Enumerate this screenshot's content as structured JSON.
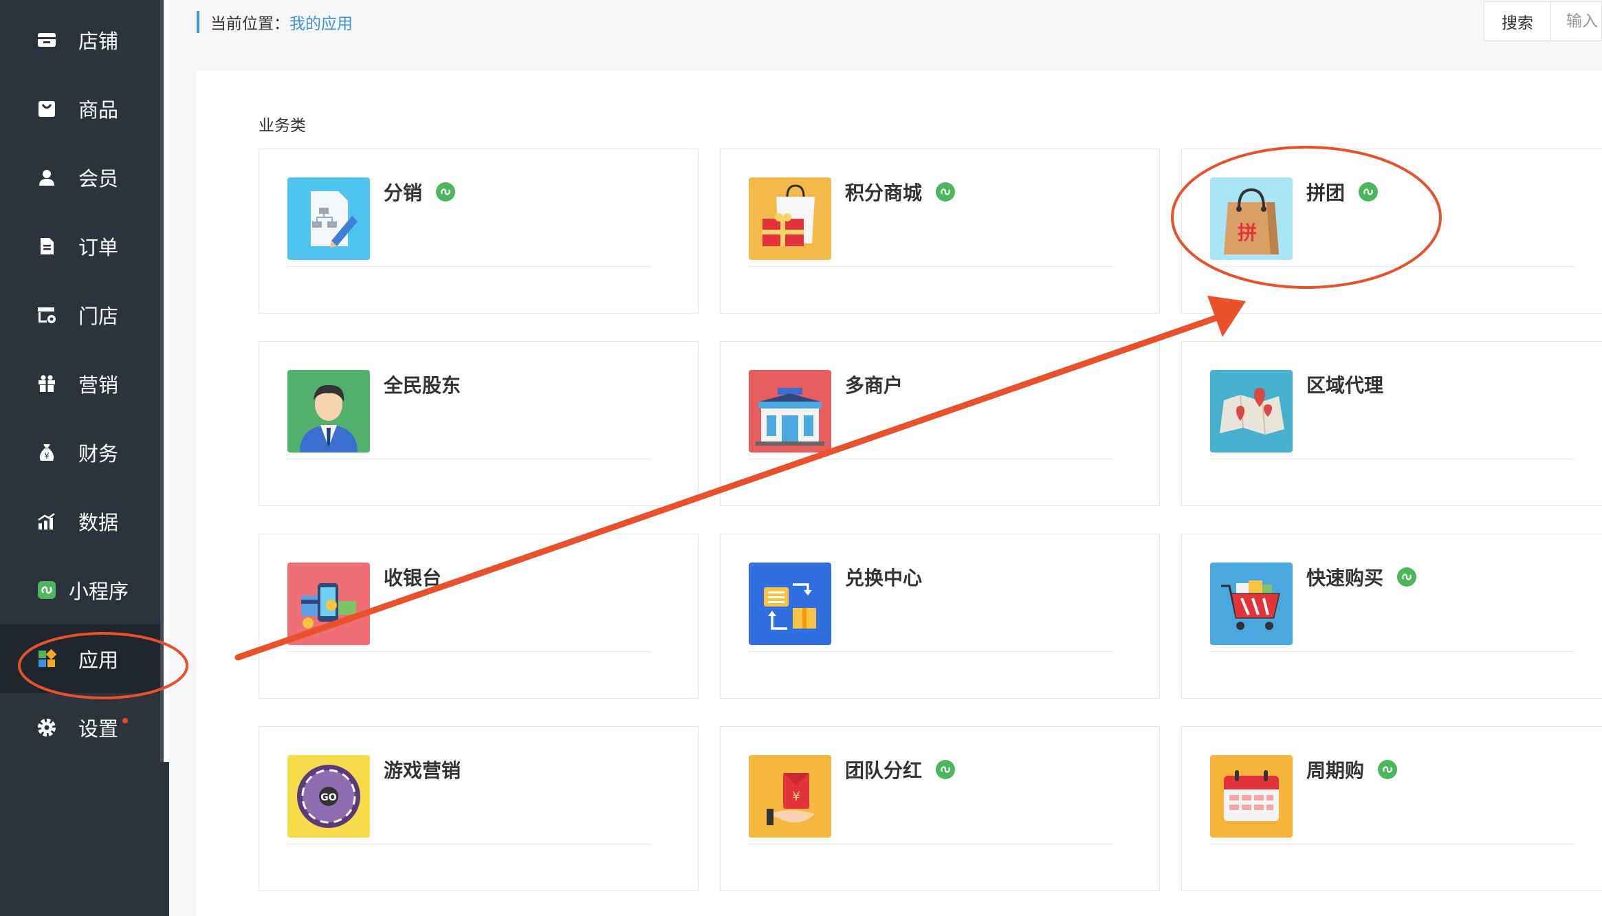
{
  "sidebar": {
    "items": [
      {
        "label": "店铺",
        "icon": "store-icon"
      },
      {
        "label": "商品",
        "icon": "shopping-bag-icon"
      },
      {
        "label": "会员",
        "icon": "user-icon"
      },
      {
        "label": "订单",
        "icon": "document-icon"
      },
      {
        "label": "门店",
        "icon": "shop-settings-icon"
      },
      {
        "label": "营销",
        "icon": "gift-icon"
      },
      {
        "label": "财务",
        "icon": "money-bag-icon"
      },
      {
        "label": "数据",
        "icon": "bar-chart-icon"
      },
      {
        "label": "小程序",
        "icon": "mini-program-icon"
      },
      {
        "label": "应用",
        "icon": "apps-grid-icon",
        "active": true
      },
      {
        "label": "设置",
        "icon": "gear-icon",
        "has_notification": true
      }
    ]
  },
  "breadcrumb": {
    "prefix": "当前位置：",
    "current": "我的应用"
  },
  "search": {
    "button_label": "搜索",
    "placeholder": "输入"
  },
  "main": {
    "section_title": "业务类",
    "apps": [
      {
        "name": "分销",
        "mini_program": true,
        "icon": "distribution-icon",
        "color": "#4ec4ee"
      },
      {
        "name": "积分商城",
        "mini_program": true,
        "icon": "points-mall-icon",
        "color": "#f3b94a"
      },
      {
        "name": "拼团",
        "mini_program": true,
        "icon": "group-buy-icon",
        "color": "#a8e6f5"
      },
      {
        "name": "全民股东",
        "mini_program": false,
        "icon": "shareholder-icon",
        "color": "#52b06d"
      },
      {
        "name": "多商户",
        "mini_program": false,
        "icon": "multi-merchant-icon",
        "color": "#e55d5d"
      },
      {
        "name": "区域代理",
        "mini_program": false,
        "icon": "regional-agent-icon",
        "color": "#46b1cf"
      },
      {
        "name": "收银台",
        "mini_program": false,
        "icon": "cashier-icon",
        "color": "#ee6f74"
      },
      {
        "name": "兑换中心",
        "mini_program": false,
        "icon": "exchange-center-icon",
        "color": "#2f6fe0"
      },
      {
        "name": "快速购买",
        "mini_program": true,
        "icon": "quick-buy-icon",
        "color": "#4aa8de"
      },
      {
        "name": "游戏营销",
        "mini_program": false,
        "icon": "game-marketing-icon",
        "color": "#f6dc4a"
      },
      {
        "name": "团队分红",
        "mini_program": true,
        "icon": "team-dividend-icon",
        "color": "#f3b83c"
      },
      {
        "name": "周期购",
        "mini_program": true,
        "icon": "periodic-purchase-icon",
        "color": "#f6b43a"
      }
    ]
  },
  "colors": {
    "sidebar_bg": "#2b333d",
    "accent_blue": "#3d8fe0",
    "annotation_red": "#e8512a",
    "mini_badge_green": "#4cb85c"
  }
}
